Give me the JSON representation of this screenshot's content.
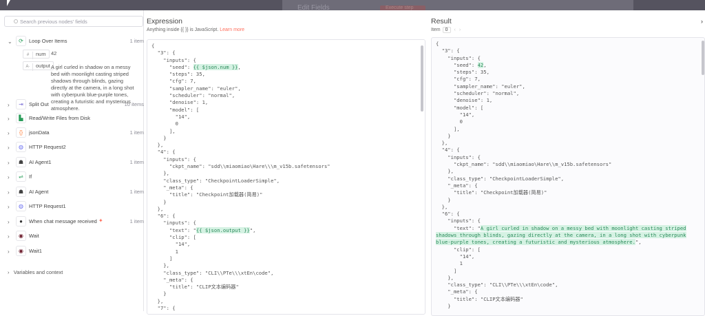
{
  "background": {
    "edit_fields": "Edit Fields",
    "execute_step": "Execute step"
  },
  "search": {
    "placeholder": "Search previous nodes' fields"
  },
  "nodes": [
    {
      "name": "Loop Over Items",
      "count": "1 item",
      "icon": "loop-icon",
      "glyph": "⟳",
      "color": "#2a9d5a",
      "expanded": true
    },
    {
      "name": "Split Out",
      "count": "10 items",
      "icon": "split-icon",
      "glyph": "⇥",
      "color": "#7b6fd6"
    },
    {
      "name": "Read/Write Files from Disk",
      "count": "",
      "icon": "file-icon",
      "glyph": "▙",
      "color": "#2a9d5a"
    },
    {
      "name": "jsonData",
      "count": "1 item",
      "icon": "braces-icon",
      "glyph": "{}",
      "color": "#ff8a4a"
    },
    {
      "name": "HTTP Request2",
      "count": "",
      "icon": "globe-icon",
      "glyph": "◍",
      "color": "#6b6ff0"
    },
    {
      "name": "AI Agent1",
      "count": "1 item",
      "icon": "robot-icon",
      "glyph": "☗",
      "color": "#444"
    },
    {
      "name": "If",
      "count": "",
      "icon": "if-icon",
      "glyph": "⇌",
      "color": "#2a9d5a"
    },
    {
      "name": "AI Agent",
      "count": "1 item",
      "icon": "robot-icon",
      "glyph": "☗",
      "color": "#444"
    },
    {
      "name": "HTTP Request1",
      "count": "",
      "icon": "globe-icon",
      "glyph": "◍",
      "color": "#6b6ff0"
    },
    {
      "name": "When chat message received",
      "count": "1 item",
      "icon": "chat-icon",
      "glyph": "●",
      "color": "#333",
      "trigger": true
    },
    {
      "name": "Wait",
      "count": "",
      "icon": "wait-icon",
      "glyph": "◉",
      "color": "#6b1a2a"
    },
    {
      "name": "Wait1",
      "count": "",
      "icon": "wait-icon",
      "glyph": "◉",
      "color": "#6b1a2a"
    }
  ],
  "fields": [
    {
      "type": "#",
      "key": "num",
      "value": "42"
    },
    {
      "type": "A·",
      "key": "output",
      "value": "A girl curled in shadow on a messy bed with moonlight casting striped shadows through blinds, gazing directly at the camera, in a long shot with cyberpunk blue-purple tones, creating a futuristic and mysterious atmosphere."
    }
  ],
  "variables_label": "Variables and context",
  "expression": {
    "title": "Expression",
    "hint": "Anything inside {{ }} is JavaScript.",
    "learn_more": "Learn more",
    "lines": [
      "{",
      "  \"3\": {",
      "    \"inputs\": {",
      [
        "      \"seed\": ",
        "{{ $json.num }}",
        ","
      ],
      "      \"steps\": 35,",
      "      \"cfg\": 7,",
      "      \"sampler_name\": \"euler\",",
      "      \"scheduler\": \"normal\",",
      "      \"denoise\": 1,",
      "      \"model\": [",
      "        \"14\",",
      "        0",
      "      ],",
      "    }",
      "  },",
      "  \"4\": {",
      "    \"inputs\": {",
      "      \"ckpt_name\": \"sdd\\\\miaomiao\\Hare\\\\\\m_v15b.safetensors\"",
      "    },",
      "    \"class_type\": \"CheckpointLoaderSimple\",",
      "    \"_meta\": {",
      "      \"title\": \"Checkpoint加载器(简易)\"",
      "    }",
      "  },",
      "  \"6\": {",
      "    \"inputs\": {",
      [
        "      \"text\": \"",
        "{{ $json.output }}",
        "\","
      ],
      "      \"clip\": [",
      "        \"14\",",
      "        1",
      "      ]",
      "    },",
      "    \"class_type\": \"CLI\\\\PTe\\\\\\xtEn\\code\",",
      "    \"_meta\": {",
      "      \"title\": \"CLIP文本编码器\"",
      "    }",
      "  },",
      "  \"7\": {"
    ]
  },
  "result": {
    "title": "Result",
    "item_label": "Item",
    "item_index": "0",
    "lines": [
      "{",
      "  \"3\": {",
      "    \"inputs\": {",
      [
        "      \"seed\": ",
        "42",
        ","
      ],
      "      \"steps\": 35,",
      "      \"cfg\": 7,",
      "      \"sampler_name\": \"euler\",",
      "      \"scheduler\": \"normal\",",
      "      \"denoise\": 1,",
      "      \"model\": [",
      "        \"14\",",
      "        0",
      "      ],",
      "    }",
      "  },",
      "  \"4\": {",
      "    \"inputs\": {",
      "      \"ckpt_name\": \"sdd\\\\miaomiao\\Hare\\\\m_v15b.safetensors\"",
      "    },",
      "    \"class_type\": \"CheckpointLoaderSimple\",",
      "    \"_meta\": {",
      "      \"title\": \"Checkpoint加载器(简易)\"",
      "    }",
      "  },",
      "  \"6\": {",
      "    \"inputs\": {",
      [
        "      \"text\": \"",
        "A girl curled in shadow on a messy bed with moonlight casting striped",
        ""
      ],
      [
        "",
        "shadows through blinds, gazing directly at the camera, in a long shot with cyberpunk",
        ""
      ],
      [
        "",
        "blue-purple tones, creating a futuristic and mysterious atmosphere.",
        "\","
      ],
      "      \"clip\": [",
      "        \"14\",",
      "        1",
      "      ]",
      "    },",
      "    \"class_type\": \"CLI\\\\PTe\\\\\\xtEn\\code\",",
      "    \"_meta\": {",
      "      \"title\": \"CLIP文本编码器\"",
      "    }"
    ]
  }
}
